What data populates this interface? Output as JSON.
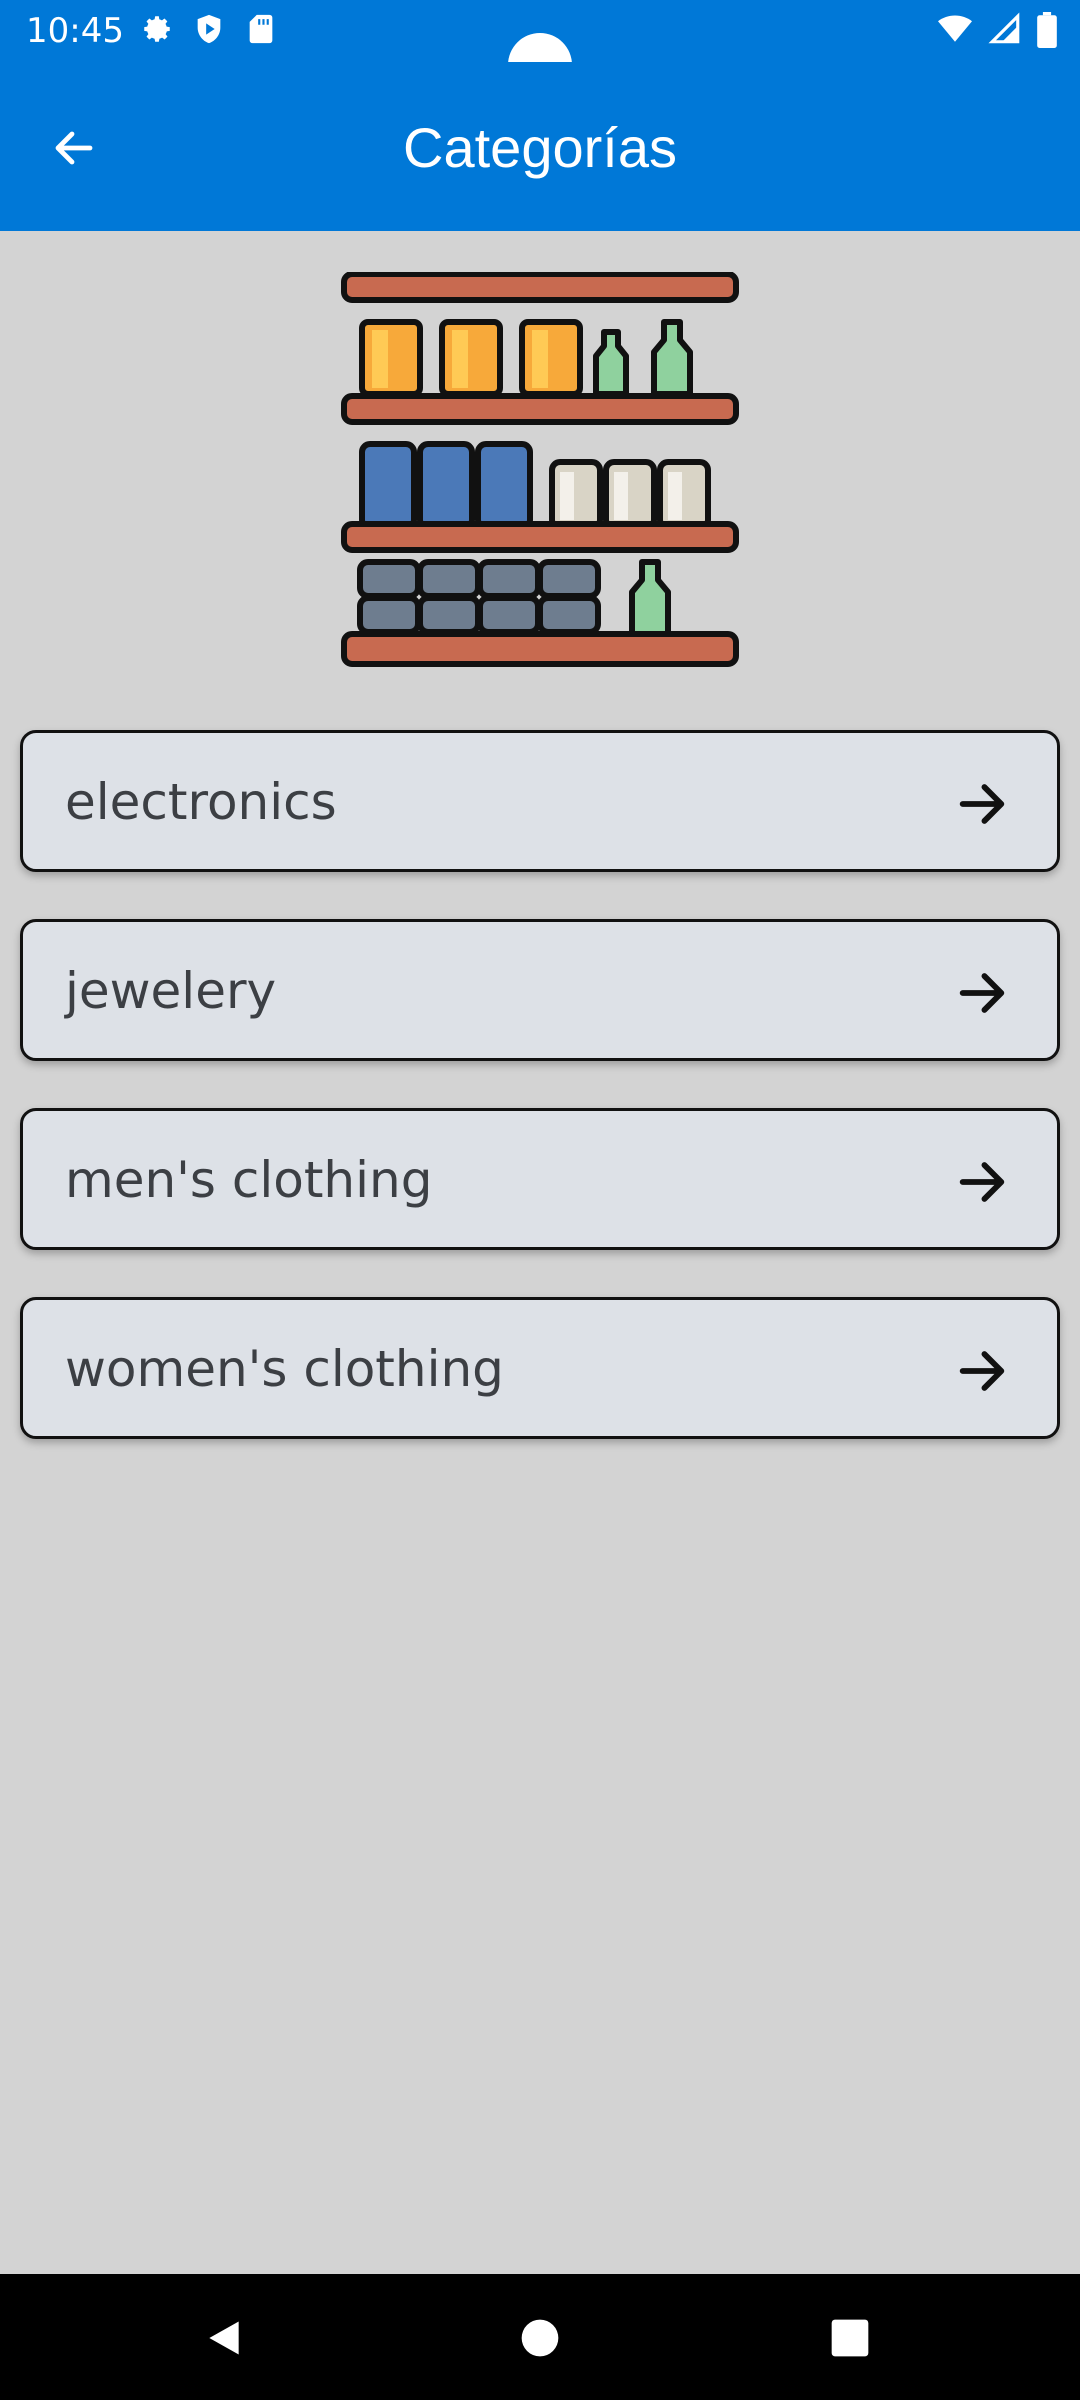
{
  "status_bar": {
    "time": "10:45",
    "left_icons": [
      "gear-icon",
      "shield-play-icon",
      "sd-card-icon"
    ],
    "right_icons": [
      "wifi-icon",
      "signal-icon",
      "battery-icon"
    ]
  },
  "app_bar": {
    "title": "Categorías",
    "back_icon": "arrow-left-icon",
    "color": "#0078d7"
  },
  "hero": {
    "icon": "store-shelf-icon"
  },
  "categories": [
    {
      "label": "electronics"
    },
    {
      "label": "jewelery"
    },
    {
      "label": "men's clothing"
    },
    {
      "label": "women's clothing"
    }
  ],
  "nav_bar": {
    "buttons": [
      "back-triangle-icon",
      "home-circle-icon",
      "recents-square-icon"
    ]
  }
}
